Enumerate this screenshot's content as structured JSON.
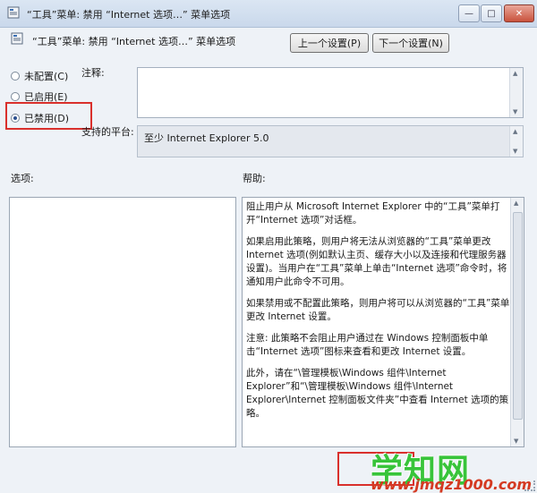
{
  "window": {
    "title": "“工具”菜单: 禁用 “Internet 选项…” 菜单选项"
  },
  "header": {
    "policy_title": "“工具”菜单: 禁用 “Internet 选项…” 菜单选项",
    "prev_button": "上一个设置(P)",
    "next_button": "下一个设置(N)"
  },
  "state_options": [
    {
      "label": "未配置(C)",
      "selected": false
    },
    {
      "label": "已启用(E)",
      "selected": false
    },
    {
      "label": "已禁用(D)",
      "selected": true
    }
  ],
  "comment": {
    "label": "注释:",
    "value": ""
  },
  "platform": {
    "label": "支持的平台:",
    "value": "至少 Internet Explorer 5.0"
  },
  "options": {
    "label": "选项:"
  },
  "help": {
    "label": "帮助:",
    "paragraphs": [
      "阻止用户从 Microsoft Internet Explorer 中的“工具”菜单打开“Internet 选项”对话框。",
      "如果启用此策略，则用户将无法从浏览器的“工具”菜单更改 Internet 选项(例如默认主页、缓存大小以及连接和代理服务器设置)。当用户在“工具”菜单上单击“Internet 选项”命令时，将通知用户此命令不可用。",
      "如果禁用或不配置此策略，则用户将可以从浏览器的“工具”菜单更改 Internet 设置。",
      "注意: 此策略不会阻止用户通过在 Windows 控制面板中单击“Internet 选项”图标来查看和更改 Internet 设置。",
      "此外，请在“\\管理模板\\Windows 组件\\Internet Explorer”和“\\管理模板\\Windows 组件\\Internet Explorer\\Internet 控制面板文件夹”中查看 Internet 选项的策略。"
    ]
  },
  "watermark": {
    "text": "学知网",
    "url": "www.jmqz1000.com"
  },
  "colors": {
    "highlight": "#d9302c",
    "watermark_green": "#38c43a",
    "watermark_red": "#d43a22"
  }
}
